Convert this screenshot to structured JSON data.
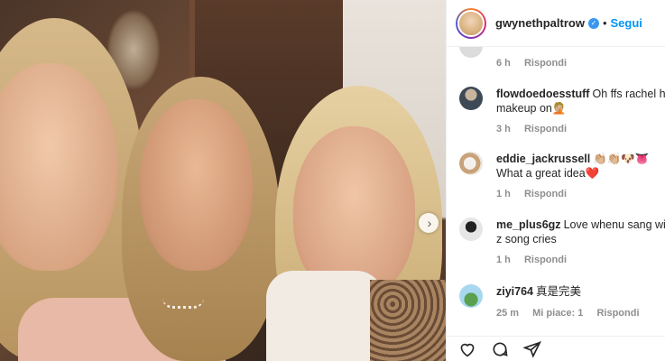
{
  "header": {
    "username": "gwynethpaltrow",
    "verified_label": "✓",
    "separator": "•",
    "follow_label": "Segui"
  },
  "comments": [
    {
      "username": "",
      "text": "",
      "time": "6 h",
      "likes": "",
      "reply": "Rispondi",
      "avatar_color": "#dcdcdc"
    },
    {
      "username": "flowdoedoesstuff",
      "text": "Oh ffs rachel has",
      "text2": "makeup on🤦🏼",
      "time": "3 h",
      "likes": "",
      "reply": "Rispondi",
      "avatar_color": "#3d4a55"
    },
    {
      "username": "eddie_jackrussell",
      "text": "👏🏼👏🏼🐶👅",
      "text2": "What a great idea❤️",
      "time": "1 h",
      "likes": "",
      "reply": "Rispondi",
      "avatar_color": "#c9a27a"
    },
    {
      "username": "me_plus6gz",
      "text": "Love whenu sang with",
      "text2": "z song cries",
      "time": "1 h",
      "likes": "",
      "reply": "Rispondi",
      "avatar_color": "#e6e6e6"
    },
    {
      "username": "ziyi764",
      "text": "真是完美",
      "text2": "",
      "time": "25 m",
      "likes": "Mi piace: 1",
      "reply": "Rispondi",
      "avatar_color": "#7cc47a"
    }
  ],
  "actions": {
    "like_icon": "heart-icon",
    "comment_icon": "comment-icon",
    "share_icon": "share-icon"
  },
  "photo": {
    "next_glyph": "›"
  },
  "colors": {
    "accent": "#0095f6",
    "verified": "#3897f0",
    "meta": "#8e8e8e"
  }
}
